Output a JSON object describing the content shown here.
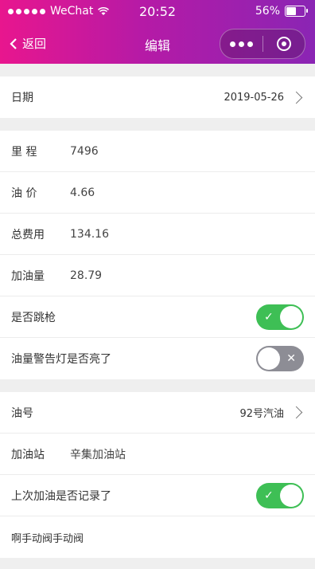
{
  "status_bar": {
    "carrier": "WeChat",
    "time": "20:52",
    "battery": "56%"
  },
  "nav": {
    "back_label": "返回",
    "title": "编辑"
  },
  "sections": [
    {
      "rows": [
        {
          "label": "日期",
          "value": "2019-05-26"
        }
      ]
    },
    {
      "rows": [
        {
          "label": "里 程",
          "value": "7496"
        },
        {
          "label": "油 价",
          "value": "4.66"
        },
        {
          "label": "总费用",
          "value": "134.16"
        },
        {
          "label": "加油量",
          "value": "28.79"
        },
        {
          "label": "是否跳枪",
          "toggle": true
        },
        {
          "label": "油量警告灯是否亮了",
          "toggle": false
        }
      ]
    },
    {
      "rows": [
        {
          "label": "油号",
          "value": "92号汽油"
        },
        {
          "label": "加油站",
          "value": "辛集加油站"
        },
        {
          "label": "上次加油是否记录了",
          "toggle": true
        },
        {
          "label": "啊手动阀手动阀"
        }
      ]
    }
  ],
  "toggle_marks": {
    "on": "✓",
    "off": "✕"
  },
  "colors": {
    "header_gradient_start": "#e8168e",
    "header_gradient_end": "#8a25b4",
    "toggle_on": "#3ebf55",
    "toggle_off": "#8d8d95"
  }
}
